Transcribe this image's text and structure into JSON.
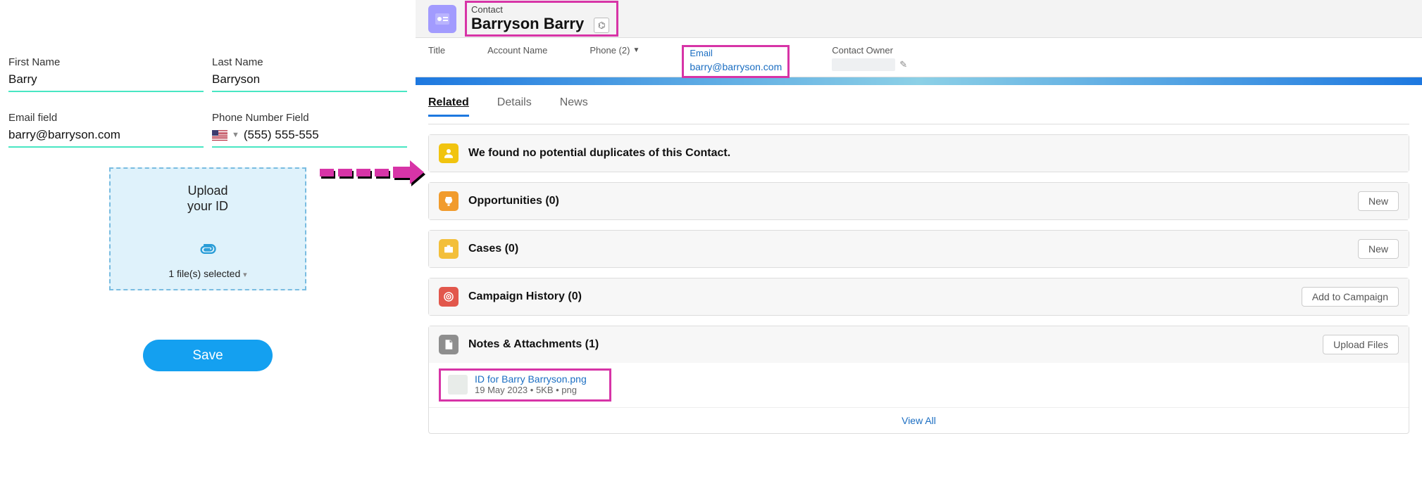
{
  "form": {
    "first_name_label": "First Name",
    "first_name_value": "Barry",
    "last_name_label": "Last Name",
    "last_name_value": "Barryson",
    "email_label": "Email field",
    "email_value": "barry@barryson.com",
    "phone_label": "Phone Number Field",
    "phone_value": "(555) 555-555",
    "upload_title": "Upload\nyour ID",
    "files_selected": "1 file(s) selected",
    "save_label": "Save"
  },
  "sf": {
    "entity_label": "Contact",
    "entity_name": "Barryson Barry",
    "info": {
      "title_label": "Title",
      "account_label": "Account Name",
      "phone_label": "Phone (2)",
      "email_label": "Email",
      "email_value": "barry@barryson.com",
      "owner_label": "Contact Owner"
    },
    "tabs": [
      "Related",
      "Details",
      "News"
    ],
    "sections": {
      "dup": "We found no potential duplicates of this Contact.",
      "opp": "Opportunities (0)",
      "cases": "Cases (0)",
      "camp": "Campaign History (0)",
      "notes": "Notes & Attachments (1)"
    },
    "buttons": {
      "new": "New",
      "add_campaign": "Add to Campaign",
      "upload_files": "Upload Files",
      "view_all": "View All"
    },
    "attachment": {
      "name": "ID for Barry  Barryson.png",
      "meta": "19 May 2023  •  5KB  •  png"
    }
  }
}
